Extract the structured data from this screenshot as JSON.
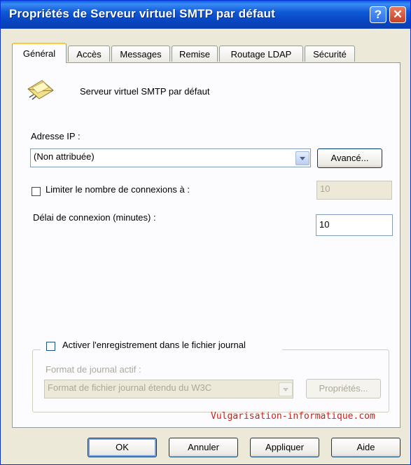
{
  "window": {
    "title": "Propriétés de Serveur virtuel SMTP par défaut",
    "help_glyph": "?",
    "close_glyph": "✕"
  },
  "tabs": [
    {
      "label": "Général",
      "active": true
    },
    {
      "label": "Accès"
    },
    {
      "label": "Messages"
    },
    {
      "label": "Remise"
    },
    {
      "label": "Routage LDAP"
    },
    {
      "label": "Sécurité"
    }
  ],
  "general": {
    "server_name": "Serveur virtuel SMTP par défaut",
    "server_icon": "mail-envelope-icon",
    "ip_label": "Adresse IP :",
    "ip_value": "(Non attribuée)",
    "advanced_button": "Avancé...",
    "limit_connections_label": "Limiter le nombre de connexions à :",
    "limit_connections_checked": false,
    "limit_connections_value": "10",
    "timeout_label": "Délai de connexion (minutes) :",
    "timeout_value": "10",
    "logging_label": "Activer l'enregistrement dans le fichier journal",
    "logging_checked": false,
    "log_format_label": "Format de journal actif :",
    "log_format_value": "Format de fichier journal étendu du W3C",
    "properties_button": "Propriétés..."
  },
  "watermark": "Vulgarisation-informatique.com",
  "footer": {
    "ok": "OK",
    "cancel": "Annuler",
    "apply": "Appliquer",
    "help": "Aide"
  },
  "colors": {
    "titlebar": "#0a5fe0",
    "dialog_bg": "#ece9d8",
    "panel_bg": "#fcfcfe",
    "active_tab_accent": "#ffc83c",
    "watermark": "#c8221a"
  }
}
